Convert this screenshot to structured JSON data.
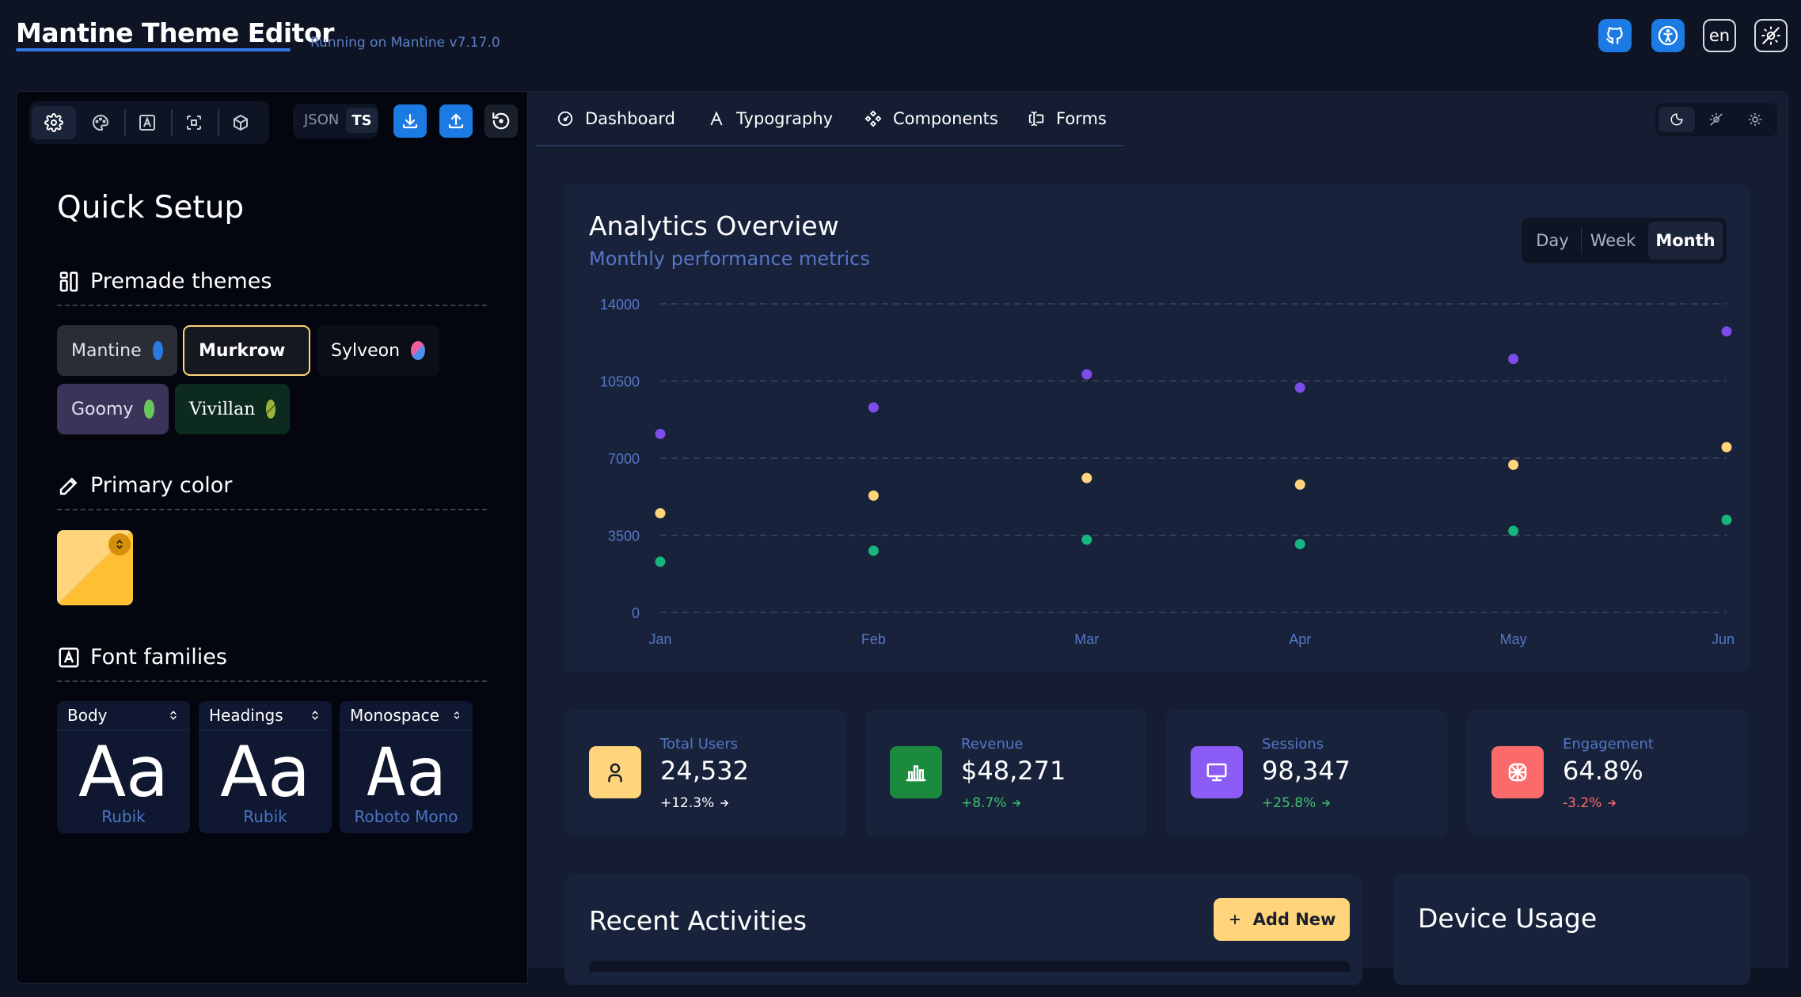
{
  "header": {
    "title": "Mantine Theme Editor",
    "version": "Running on Mantine v7.17.0",
    "lang": "en"
  },
  "toolbar": {
    "json_label": "JSON",
    "ts_label": "TS"
  },
  "sidebar": {
    "quick_setup": "Quick Setup",
    "premade_title": "Premade themes",
    "themes": [
      {
        "name": "Mantine",
        "swatch": "#2b79de"
      },
      {
        "name": "Murkrow",
        "swatch": "#ffc34d"
      },
      {
        "name": "Sylveon",
        "swatch": "#ec6ca9"
      },
      {
        "name": "Goomy",
        "swatch": "#6ac75c"
      },
      {
        "name": "Vivillan",
        "swatch": "#9ab43a"
      }
    ],
    "primary_color_title": "Primary color",
    "primary_color": "#ffc34d",
    "font_families_title": "Font families",
    "fonts": [
      {
        "label": "Body",
        "sample": "Aa",
        "family": "Rubik"
      },
      {
        "label": "Headings",
        "sample": "Aa",
        "family": "Rubik"
      },
      {
        "label": "Monospace",
        "sample": "Aa",
        "family": "Roboto Mono"
      }
    ]
  },
  "tabs": [
    {
      "label": "Dashboard"
    },
    {
      "label": "Typography"
    },
    {
      "label": "Components"
    },
    {
      "label": "Forms"
    }
  ],
  "analytics": {
    "title": "Analytics Overview",
    "subtitle": "Monthly performance metrics",
    "periods": [
      "Day",
      "Week",
      "Month"
    ],
    "selected_period": "Month"
  },
  "chart_data": {
    "type": "scatter",
    "title": "",
    "categories": [
      "Jan",
      "Feb",
      "Mar",
      "Apr",
      "May",
      "Jun"
    ],
    "ylim": [
      0,
      14000
    ],
    "yticks": [
      0,
      3500,
      7000,
      10500,
      14000
    ],
    "grid": true,
    "series": [
      {
        "color": "#7c4dea",
        "values": [
          8100,
          9300,
          10800,
          10200,
          11500,
          12750
        ]
      },
      {
        "color": "#ffd47a",
        "values": [
          4500,
          5300,
          6100,
          5800,
          6700,
          7500
        ]
      },
      {
        "color": "#15b57d",
        "values": [
          2300,
          2800,
          3300,
          3100,
          3700,
          4200
        ]
      }
    ]
  },
  "stats": [
    {
      "label": "Total Users",
      "value": "24,532",
      "change": "+12.3%",
      "icon": "user-icon",
      "icon_bg": "#ffd47a",
      "change_color": "#ffffff"
    },
    {
      "label": "Revenue",
      "value": "$48,271",
      "change": "+8.7%",
      "icon": "bar-chart-icon",
      "icon_bg": "#1b8a3d",
      "change_color": "#3ec46d"
    },
    {
      "label": "Sessions",
      "value": "98,347",
      "change": "+25.8%",
      "icon": "monitor-icon",
      "icon_bg": "#8b5cf6",
      "change_color": "#3ec46d"
    },
    {
      "label": "Engagement",
      "value": "64.8%",
      "change": "-3.2%",
      "icon": "cookie-icon",
      "icon_bg": "#fb6b6b",
      "change_color": "#fb6b6b"
    }
  ],
  "activities": {
    "title": "Recent Activities",
    "add_label": "Add New"
  },
  "device": {
    "title": "Device Usage"
  }
}
